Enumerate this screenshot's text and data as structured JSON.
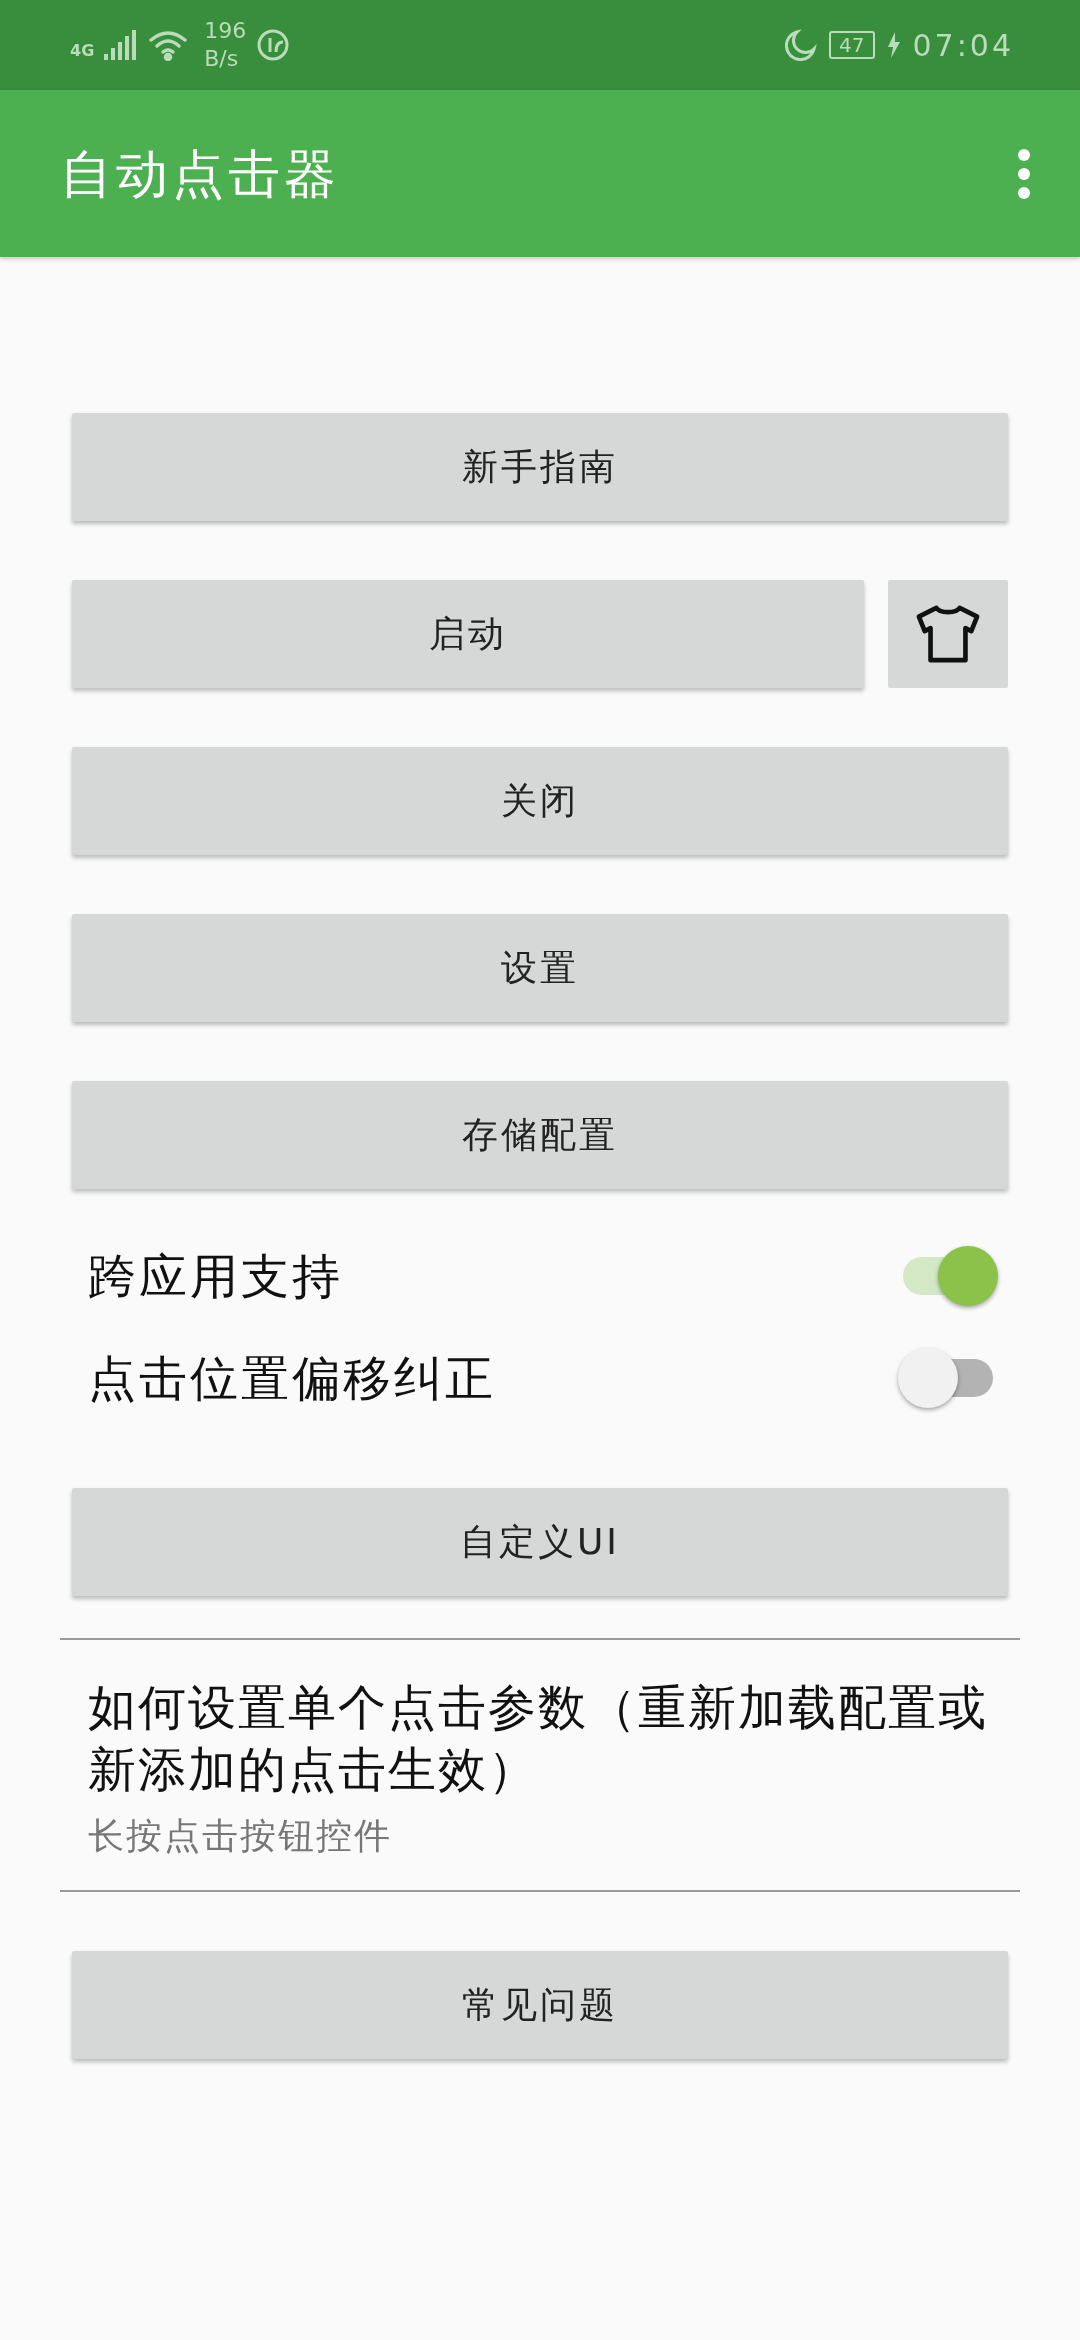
{
  "status_bar": {
    "network": "4G",
    "speed_value": "196",
    "speed_unit": "B/s",
    "battery": "47",
    "time": "07:04"
  },
  "app_bar": {
    "title": "自动点击器"
  },
  "items": [
    {
      "kind": "button",
      "label": "新手指南"
    },
    {
      "kind": "button_with_icon",
      "label": "启动"
    },
    {
      "kind": "button",
      "label": "关闭"
    },
    {
      "kind": "button",
      "label": "设置"
    },
    {
      "kind": "button",
      "label": "存储配置"
    },
    {
      "kind": "switch",
      "label": "跨应用支持",
      "on": true
    },
    {
      "kind": "switch",
      "label": "点击位置偏移纠正",
      "on": false
    },
    {
      "kind": "button",
      "label": "自定义UI"
    },
    {
      "kind": "info",
      "title": "如何设置单个点击参数（重新加载配置或新添加的点击生效）",
      "subtitle": "长按点击按钮控件"
    },
    {
      "kind": "button",
      "label": "常见问题"
    }
  ]
}
